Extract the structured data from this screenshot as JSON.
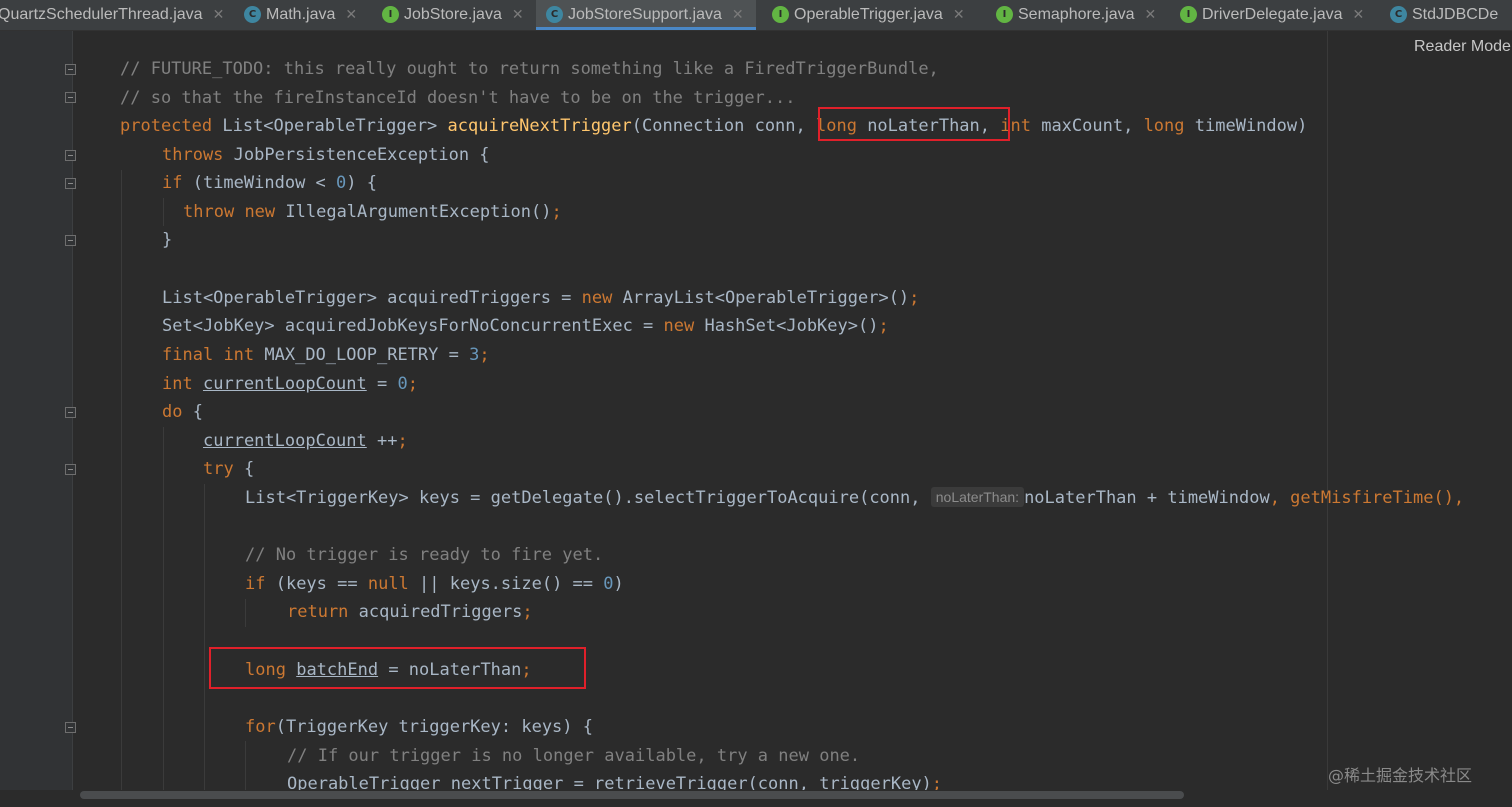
{
  "tabs": [
    {
      "label": "QuartzSchedulerThread.java",
      "icon": "class-icon",
      "active": false
    },
    {
      "label": "Math.java",
      "icon": "class-icon",
      "active": false
    },
    {
      "label": "JobStore.java",
      "icon": "interface-icon",
      "active": false
    },
    {
      "label": "JobStoreSupport.java",
      "icon": "class-icon",
      "active": true
    },
    {
      "label": "OperableTrigger.java",
      "icon": "interface-icon",
      "active": false
    },
    {
      "label": "Semaphore.java",
      "icon": "interface-icon",
      "active": false
    },
    {
      "label": "DriverDelegate.java",
      "icon": "interface-icon",
      "active": false
    },
    {
      "label": "StdJDBCDe",
      "icon": "class-icon",
      "active": false
    }
  ],
  "reader_mode": "Reader Mode",
  "watermark": "@稀土掘金技术社区",
  "colors": {
    "keyword": "#cc7832",
    "comment": "#808080",
    "method": "#ffc66d",
    "number": "#6897bb",
    "text": "#a9b7c6",
    "highlight_box": "#e0202a",
    "active_tab_underline": "#4a88c7"
  },
  "code": {
    "l1": "// FUTURE_TODO: this really ought to return something like a FiredTriggerBundle,",
    "l2": "// so that the fireInstanceId doesn't have to be on the trigger...",
    "l3": {
      "protected": "protected",
      "type": " List<OperableTrigger> ",
      "method": "acquireNextTrigger",
      "args1": "(Connection conn, ",
      "long1": "long",
      "p1": " noLaterThan, ",
      "int1": "int",
      "p2": " maxCount, ",
      "long2": "long",
      "p3": " timeWindow)"
    },
    "l4": {
      "throws": "throws",
      "rest": " JobPersistenceException {"
    },
    "l5": {
      "if": "if",
      "a": " (timeWindow < ",
      "n": "0",
      "b": ") {"
    },
    "l6": {
      "throw": "throw",
      "new": "new",
      "rest": " IllegalArgumentException()",
      "semi": ";"
    },
    "l7": "}",
    "l8": {
      "a": "List<OperableTrigger> acquiredTriggers = ",
      "new": "new",
      "b": " ArrayList<OperableTrigger>()",
      "semi": ";"
    },
    "l9": {
      "a": "Set<JobKey> acquiredJobKeysForNoConcurrentExec = ",
      "new": "new",
      "b": " HashSet<JobKey>()",
      "semi": ";"
    },
    "l10": {
      "final": "final",
      "int": "int",
      "a": " MAX_DO_LOOP_RETRY = ",
      "n": "3",
      "semi": ";"
    },
    "l11": {
      "int": "int",
      "var": "currentLoopCount",
      "a": " = ",
      "n": "0",
      "semi": ";"
    },
    "l12": {
      "do": "do",
      "rest": " {"
    },
    "l13": {
      "var": "currentLoopCount",
      "a": " ++",
      "semi": ";"
    },
    "l14": {
      "try": "try",
      "rest": " {"
    },
    "l15": {
      "a": "List<TriggerKey> keys = getDelegate().selectTriggerToAcquire(conn,",
      "hint": "noLaterThan:",
      "b": "noLaterThan + timeWindow",
      "c": ", getMisfireTime(),"
    },
    "l16": "// No trigger is ready to fire yet.",
    "l17": {
      "if": "if",
      "a": " (keys == ",
      "null": "null",
      "b": " || keys.size() == ",
      "n": "0",
      "c": ")"
    },
    "l18": {
      "return": "return",
      "rest": " acquiredTriggers",
      "semi": ";"
    },
    "l19": {
      "long": "long",
      "var": "batchEnd",
      "rest": " = noLaterThan",
      "semi": ";"
    },
    "l20": {
      "for": "for",
      "rest": "(TriggerKey triggerKey: keys) {"
    },
    "l21": "// If our trigger is no longer available, try a new one.",
    "l22": {
      "a": "OperableTrigger nextTrigger = retrieveTrigger(conn, triggerKey)",
      "semi": ";"
    }
  }
}
